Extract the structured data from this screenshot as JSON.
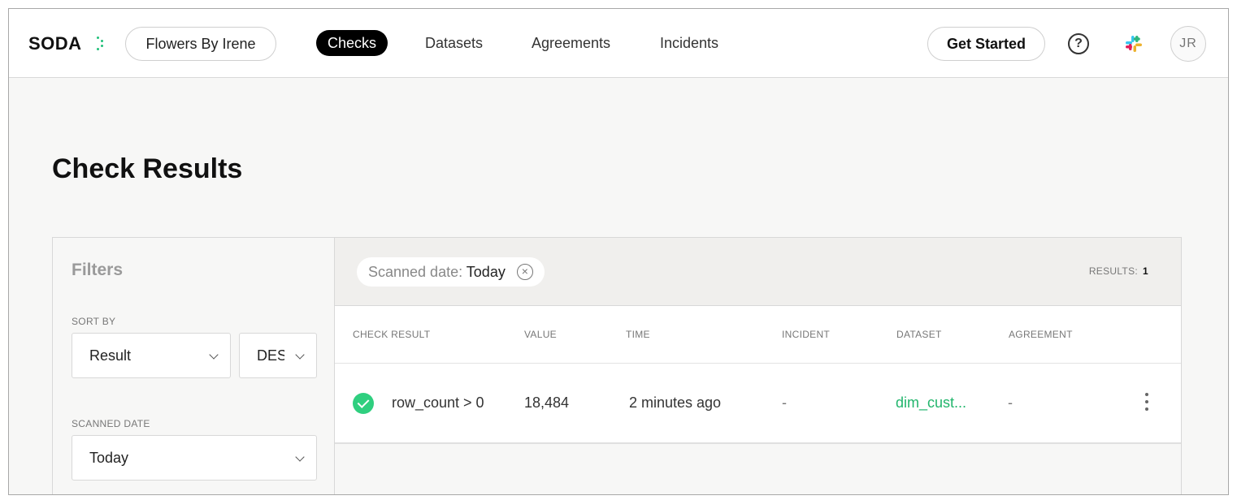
{
  "header": {
    "logo": "SODA",
    "org_name": "Flowers By Irene",
    "nav": [
      "Checks",
      "Datasets",
      "Agreements",
      "Incidents"
    ],
    "active_nav": "Checks",
    "get_started": "Get Started",
    "help_icon": "?",
    "slack_icon": "slack-icon",
    "avatar_initials": "JR",
    "colors": {
      "accent": "#21c07a",
      "active_nav_bg": "#000000"
    }
  },
  "page": {
    "title": "Check Results"
  },
  "filters": {
    "title": "Filters",
    "sort_by_label": "SORT BY",
    "sort_field": "Result",
    "sort_order": "DESC",
    "scanned_date_label": "SCANNED DATE",
    "scanned_date_value": "Today"
  },
  "results": {
    "chip_key": "Scanned date:",
    "chip_value": "Today",
    "count_label": "RESULTS:",
    "count": "1",
    "columns": [
      "CHECK RESULT",
      "VALUE",
      "TIME",
      "INCIDENT",
      "DATASET",
      "AGREEMENT"
    ],
    "rows": [
      {
        "status": "pass",
        "check": "row_count > 0",
        "value": "18,484",
        "time": "2 minutes ago",
        "incident": "-",
        "dataset": "dim_cust...",
        "agreement": "-"
      }
    ],
    "colors": {
      "pass": "#2fcf7f",
      "dataset_link": "#21b56c"
    }
  }
}
